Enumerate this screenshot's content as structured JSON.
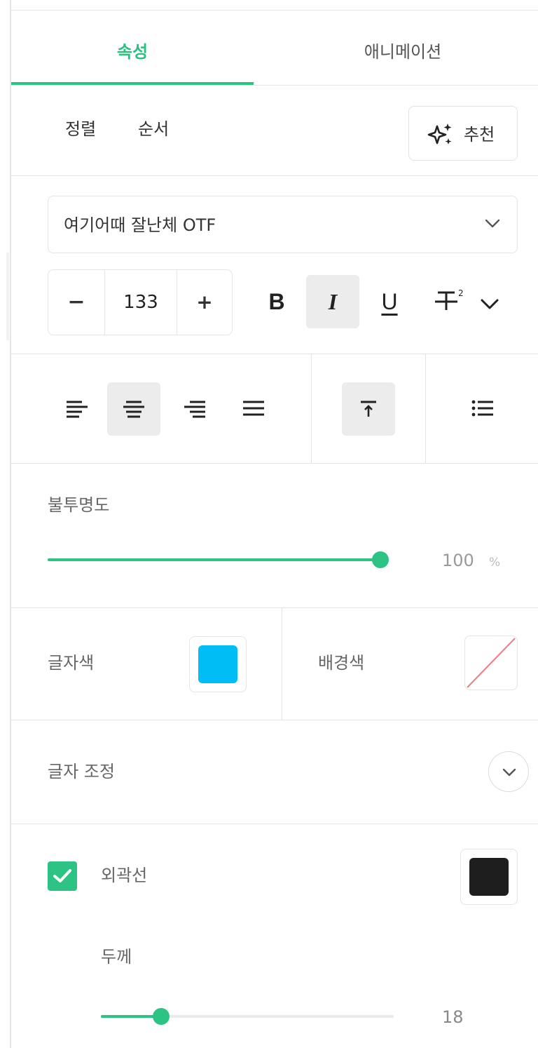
{
  "tabs": [
    {
      "label": "속성",
      "active": true
    },
    {
      "label": "애니메이션",
      "active": false
    }
  ],
  "subtabs": [
    "정렬",
    "순서"
  ],
  "recommend": {
    "label": "추천",
    "icon": "sparkle-icon"
  },
  "font": {
    "selected": "여기어때 잘난체 OTF",
    "icon": "chevron-down-icon"
  },
  "font_size": {
    "value": "133",
    "minus": "−",
    "plus": "+"
  },
  "format": {
    "bold": "B",
    "italic": "I",
    "underline": "U",
    "active": "italic"
  },
  "alignment": {
    "active": "center",
    "vertical_active": "top"
  },
  "opacity": {
    "label": "불투명도",
    "value": "100",
    "unit": "%",
    "level": 1.0
  },
  "colors": {
    "text_label": "글자색",
    "text_color": "#00bdf5",
    "bg_label": "배경색",
    "bg_color": "none"
  },
  "text_adjust": {
    "label": "글자 조정"
  },
  "outline": {
    "label": "외곽선",
    "checked": true,
    "color": "#1e1e1e",
    "thickness_label": "두께",
    "thickness_value": "18",
    "thickness_level": 0.2
  },
  "theme": {
    "accent": "#2cc385"
  }
}
